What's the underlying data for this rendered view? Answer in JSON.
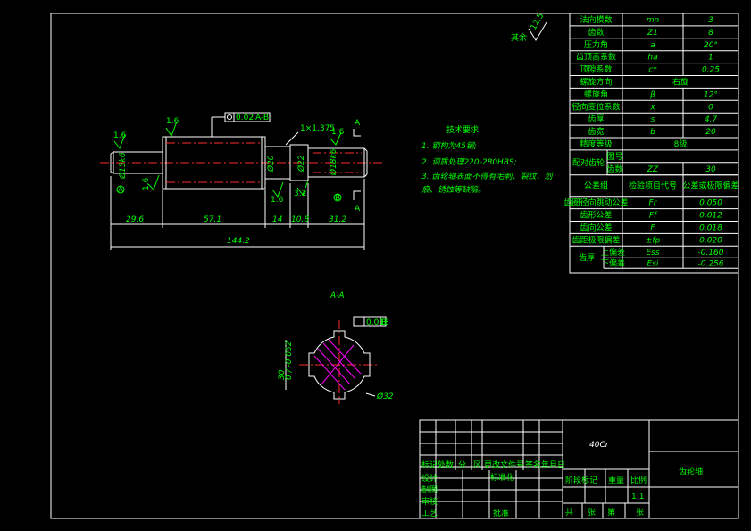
{
  "params_table": {
    "rows": [
      {
        "name": "法向模数",
        "sym": "mn",
        "val": "3"
      },
      {
        "name": "齿数",
        "sym": "Z1",
        "val": "8"
      },
      {
        "name": "压力角",
        "sym": "a",
        "val": "20°"
      },
      {
        "name": "齿顶高系数",
        "sym": "ha",
        "val": "1"
      },
      {
        "name": "顶隙系数",
        "sym": "c*",
        "val": "0.25"
      },
      {
        "name": "螺旋方向",
        "sym": "",
        "val": "右旋"
      },
      {
        "name": "螺旋角",
        "sym": "β",
        "val": "12°"
      },
      {
        "name": "径向变位系数",
        "sym": "x",
        "val": "0"
      },
      {
        "name": "齿厚",
        "sym": "s",
        "val": "4.7"
      },
      {
        "name": "齿宽",
        "sym": "b",
        "val": "20"
      },
      {
        "name": "精度等级",
        "sym": "",
        "val": "8级"
      }
    ],
    "mating_label": "配对齿轮",
    "mating_rows": [
      {
        "name": "图号",
        "sym": "",
        "val": ""
      },
      {
        "name": "齿数",
        "sym": "ZZ",
        "val": "30"
      }
    ],
    "tolerance_header": {
      "group": "公差组",
      "item": "检验项目代号",
      "value": "公差或极限偏差"
    },
    "tolerance_rows": [
      {
        "name": "齿圈径向跳动公差",
        "sym": "Fr",
        "val": "0.050"
      },
      {
        "name": "齿形公差",
        "sym": "Ff",
        "val": "0.012"
      },
      {
        "name": "齿向公差",
        "sym": "F",
        "val": "0.018"
      },
      {
        "name": "齿距极限偏差",
        "sym": "±fp",
        "val": "0.020"
      }
    ],
    "thickness_label": "齿厚",
    "thickness_rows": [
      {
        "name": "上偏差",
        "sym": "Ess",
        "val": "-0.160"
      },
      {
        "name": "下偏差",
        "sym": "Esi",
        "val": "-0.256"
      }
    ]
  },
  "surface_finish": {
    "label": "其余",
    "value": "12.5"
  },
  "tech_requirements": {
    "title": "技术要求",
    "items": [
      "1. 钢构为45钢;",
      "2. 调质处理220-280HBS;",
      "3. 齿轮轴表面不得有毛刺、裂纹、划",
      "   痕、锈蚀等缺陷。"
    ]
  },
  "drawing_dims": {
    "chamfer": "1×1.375",
    "geom_tol": "0.02",
    "datum": "A-B",
    "roughness": [
      "1.6",
      "1.6",
      "1.6",
      "1.6",
      "1.6",
      "3.2"
    ],
    "diameters": [
      "Ø15k6",
      "Ø20",
      "Ø22",
      "Ø18k6"
    ],
    "lengths": [
      "29.6",
      "57.1",
      "14",
      "10.8",
      "31.2",
      "144.2"
    ],
    "balloons": [
      "A",
      "B"
    ],
    "section_marks": [
      "A",
      "A"
    ]
  },
  "section_view": {
    "label": "A-A",
    "keyway_depth": "30",
    "keyway_tol": "0 / -0.052",
    "keyway_geom_tol": "0.018",
    "keyway_datum": "B",
    "diameter": "Ø32"
  },
  "title_block": {
    "material": "40Cr",
    "part_name": "齿轮轴",
    "header_row": [
      "标记",
      "处数",
      "分",
      "区",
      "更改文件号",
      "签名",
      "年月日"
    ],
    "rows_left": [
      "设计",
      "制图",
      "审核",
      "工艺"
    ],
    "std_label": "标准化",
    "approve_label": "批准",
    "stage_labels": [
      "阶段标记",
      "重量",
      "比例"
    ],
    "scale": "1:1",
    "sheet_labels": [
      "共",
      "张",
      "第",
      "张"
    ]
  }
}
